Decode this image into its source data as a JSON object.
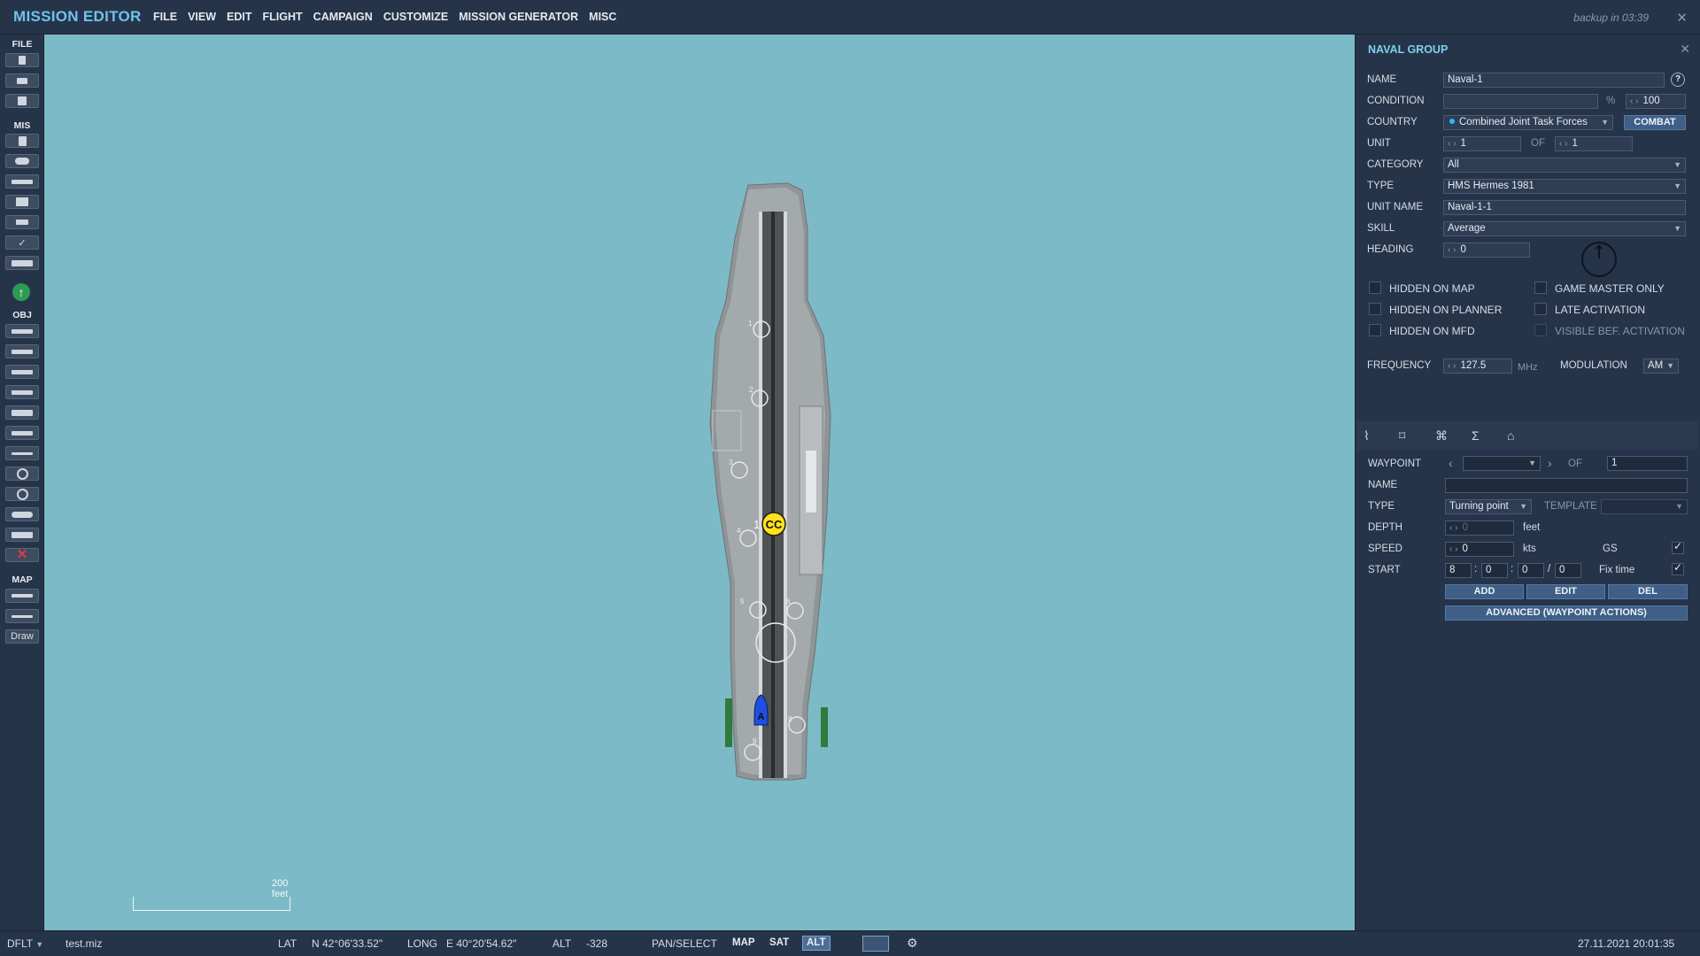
{
  "app": {
    "title": "MISSION EDITOR",
    "backup_note": "backup in 03:39",
    "close_glyph": "✕"
  },
  "menu": [
    "FILE",
    "VIEW",
    "EDIT",
    "FLIGHT",
    "CAMPAIGN",
    "CUSTOMIZE",
    "MISSION GENERATOR",
    "MISC"
  ],
  "toolbar": {
    "sections": {
      "file": "FILE",
      "mis": "MIS",
      "obj": "OBJ",
      "map": "MAP"
    },
    "draw_label": "Draw",
    "file_icons": [
      "new-mission-icon",
      "open-mission-icon",
      "save-mission-icon"
    ],
    "mis_icons": [
      "briefing-icon",
      "weather-icon",
      "triggers-icon",
      "goals-icon",
      "flag-icon",
      "checkmark-icon",
      "resources-icon"
    ],
    "obj_icons": [
      "plane-icon",
      "helicopter-icon",
      "ship-icon",
      "vehicle-icon",
      "static-object-icon",
      "airfield-icon",
      "trigger-zone-icon",
      "target-icon",
      "nav-point-icon",
      "link-icon",
      "template-icon",
      "delete-icon"
    ],
    "map_icons": [
      "zoom-icon",
      "ruler-icon"
    ]
  },
  "map": {
    "background": "#7cbac7",
    "scale_label": "200 feet",
    "marker_cc": "CC",
    "marker_a": "A",
    "marker_1": "1",
    "deck_numbers": [
      "1",
      "2",
      "3",
      "4",
      "5",
      "6",
      "7",
      "8",
      "9"
    ]
  },
  "panel": {
    "title": "NAVAL GROUP",
    "close_glyph": "✕",
    "labels": {
      "name": "NAME",
      "condition": "CONDITION",
      "country": "COUNTRY",
      "unit": "UNIT",
      "category": "CATEGORY",
      "type": "TYPE",
      "unit_name": "UNIT NAME",
      "skill": "SKILL",
      "heading": "HEADING",
      "frequency": "FREQUENCY",
      "modulation": "MODULATION",
      "of": "OF",
      "percent": "%",
      "mhz": "MHz"
    },
    "values": {
      "name": "Naval-1",
      "condition": "",
      "condition_pct": "100",
      "country": "Combined Joint Task Forces",
      "combat_button": "COMBAT",
      "unit": "1",
      "unit_of": "1",
      "category": "All",
      "type": "HMS Hermes 1981",
      "unit_name": "Naval-1-1",
      "skill": "Average",
      "heading": "0",
      "frequency": "127.5",
      "modulation": "AM"
    },
    "checkboxes": [
      {
        "label": "HIDDEN ON MAP",
        "checked": false
      },
      {
        "label": "HIDDEN ON PLANNER",
        "checked": false
      },
      {
        "label": "HIDDEN ON MFD",
        "checked": false
      },
      {
        "label": "GAME MASTER ONLY",
        "checked": false
      },
      {
        "label": "LATE ACTIVATION",
        "checked": false
      },
      {
        "label": "VISIBLE BEF. ACTIVATION",
        "checked": false,
        "disabled": true
      }
    ],
    "tabs": [
      "route-tab-icon",
      "targets-tab-icon",
      "actions-tab-icon",
      "summary-tab-icon",
      "payload-tab-icon"
    ],
    "waypoint": {
      "labels": {
        "waypoint": "WAYPOINT",
        "of": "OF",
        "name": "NAME",
        "type": "TYPE",
        "template": "TEMPLATE",
        "depth": "DEPTH",
        "speed": "SPEED",
        "start": "START",
        "feet": "feet",
        "kts": "kts",
        "gs": "GS",
        "fix_time": "Fix time"
      },
      "values": {
        "current": "",
        "total": "1",
        "name": "",
        "type": "Turning point",
        "template": "",
        "depth": "0",
        "speed": "0",
        "start_h": "8",
        "start_m": "0",
        "start_s": "0",
        "start_d": "0",
        "gs_checked": true,
        "fix_time_checked": true
      },
      "buttons": {
        "add": "ADD",
        "edit": "EDIT",
        "del": "DEL",
        "advanced": "ADVANCED (WAYPOINT ACTIONS)"
      }
    }
  },
  "status": {
    "mode": "DFLT",
    "file": "test.miz",
    "lat_label": "LAT",
    "lat": "N 42°06'33.52\"",
    "long_label": "LONG",
    "long": "E 40°20'54.62\"",
    "alt_label": "ALT",
    "alt": "-328",
    "pan_select": "PAN/SELECT",
    "map_btn": "MAP",
    "sat_btn": "SAT",
    "alt_btn": "ALT",
    "datetime": "27.11.2021 20:01:35"
  }
}
